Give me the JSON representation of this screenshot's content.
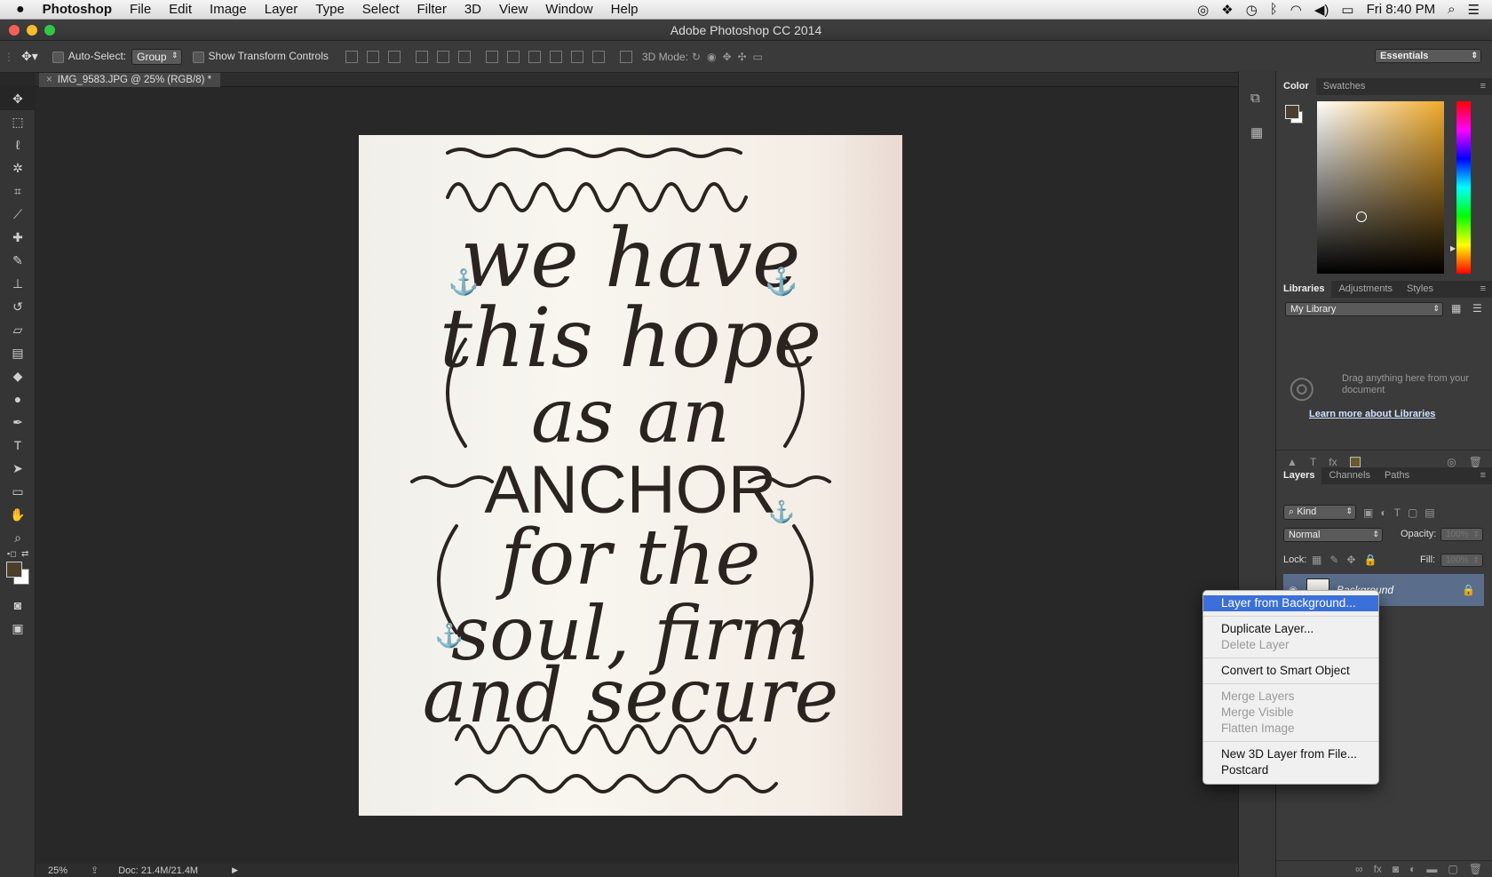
{
  "menubar": {
    "apple": "",
    "items": [
      "Photoshop",
      "File",
      "Edit",
      "Image",
      "Layer",
      "Type",
      "Select",
      "Filter",
      "3D",
      "View",
      "Window",
      "Help"
    ],
    "clock": "Fri 8:40 PM"
  },
  "window": {
    "title": "Adobe Photoshop CC 2014"
  },
  "options": {
    "auto_select_label": "Auto-Select:",
    "auto_select_value": "Group",
    "show_transform_label": "Show Transform Controls",
    "mode_3d_label": "3D Mode:",
    "workspace": "Essentials"
  },
  "document": {
    "tab_label": "IMG_9583.JPG @ 25% (RGB/8) *",
    "artwork_lines": [
      "we have",
      "this hope",
      "as an",
      "ANCHOR",
      "for the",
      "soul, firm",
      "and secure"
    ]
  },
  "status": {
    "zoom": "25%",
    "doc_size": "Doc: 21.4M/21.4M"
  },
  "color_panel": {
    "tabs": [
      "Color",
      "Swatches"
    ],
    "foreground": "#4a3f2c",
    "background": "#ffffff"
  },
  "libraries_panel": {
    "tabs": [
      "Libraries",
      "Adjustments",
      "Styles"
    ],
    "library": "My Library",
    "empty_text": "Drag anything here from your document",
    "learn_link": "Learn more about Libraries"
  },
  "layers_panel": {
    "tabs": [
      "Layers",
      "Channels",
      "Paths"
    ],
    "filter": "Kind",
    "blend_mode": "Normal",
    "opacity_label": "Opacity:",
    "opacity_value": "100%",
    "lock_label": "Lock:",
    "fill_label": "Fill:",
    "fill_value": "100%",
    "layer_name": "Background"
  },
  "context_menu": {
    "groups": [
      [
        {
          "label": "Layer from Background...",
          "state": "highlighted"
        }
      ],
      [
        {
          "label": "Duplicate Layer...",
          "state": "enabled"
        },
        {
          "label": "Delete Layer",
          "state": "disabled"
        }
      ],
      [
        {
          "label": "Convert to Smart Object",
          "state": "enabled"
        }
      ],
      [
        {
          "label": "Merge Layers",
          "state": "disabled"
        },
        {
          "label": "Merge Visible",
          "state": "disabled"
        },
        {
          "label": "Flatten Image",
          "state": "disabled"
        }
      ],
      [
        {
          "label": "New 3D Layer from File...",
          "state": "enabled"
        },
        {
          "label": "Postcard",
          "state": "enabled"
        }
      ]
    ]
  }
}
